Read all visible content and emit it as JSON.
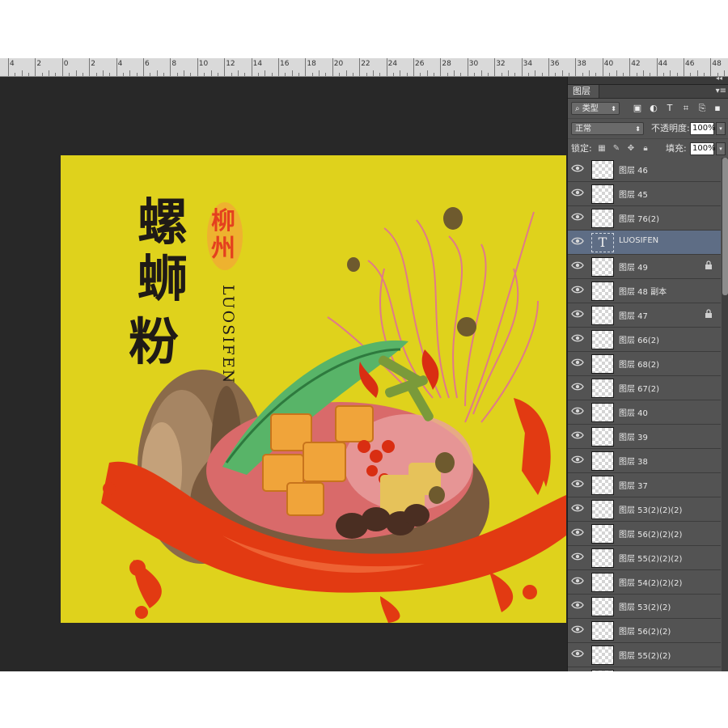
{
  "ruler": {
    "labels": [
      "4",
      "2",
      "0",
      "2",
      "4",
      "6",
      "8",
      "10",
      "12",
      "14",
      "16",
      "18",
      "20",
      "22",
      "24",
      "26",
      "28",
      "30",
      "32",
      "34",
      "36",
      "38",
      "40",
      "42",
      "44",
      "46",
      "48"
    ]
  },
  "artwork": {
    "title_chars": [
      "螺",
      "蛳",
      "粉"
    ],
    "seal_chars": [
      "柳",
      "州"
    ],
    "latin_text": "LUOSIFEN",
    "colors": {
      "background": "#dfd21c",
      "sauce": "#e23a12",
      "title": "#1f1a16",
      "seal": "#e4401e"
    }
  },
  "panel": {
    "tab_label": "图层",
    "menu_icon": "panel-menu-icon",
    "filter": {
      "kind_label": "类型",
      "icons": [
        "image-filter-icon",
        "adjustment-filter-icon",
        "text-filter-icon",
        "shape-filter-icon",
        "smart-object-filter-icon"
      ]
    },
    "blend": {
      "mode": "正常",
      "opacity_label": "不透明度:",
      "opacity_value": "100%"
    },
    "lock": {
      "label": "锁定:",
      "icons": [
        "lock-transparent-icon",
        "lock-image-icon",
        "lock-position-icon",
        "lock-all-icon"
      ],
      "fill_label": "填充:",
      "fill_value": "100%"
    },
    "layers": [
      {
        "name": "图层 46",
        "selected": false,
        "text": false,
        "locked": false
      },
      {
        "name": "图层 45",
        "selected": false,
        "text": false,
        "locked": false
      },
      {
        "name": "图层 76(2)",
        "selected": false,
        "text": false,
        "locked": false
      },
      {
        "name": "LUOSIFEN",
        "selected": true,
        "text": true,
        "locked": false
      },
      {
        "name": "图层 49",
        "selected": false,
        "text": false,
        "locked": true
      },
      {
        "name": "图层 48 副本",
        "selected": false,
        "text": false,
        "locked": false
      },
      {
        "name": "图层 47",
        "selected": false,
        "text": false,
        "locked": true
      },
      {
        "name": "图层 66(2)",
        "selected": false,
        "text": false,
        "locked": false
      },
      {
        "name": "图层 68(2)",
        "selected": false,
        "text": false,
        "locked": false
      },
      {
        "name": "图层 67(2)",
        "selected": false,
        "text": false,
        "locked": false
      },
      {
        "name": "图层 40",
        "selected": false,
        "text": false,
        "locked": false
      },
      {
        "name": "图层 39",
        "selected": false,
        "text": false,
        "locked": false
      },
      {
        "name": "图层 38",
        "selected": false,
        "text": false,
        "locked": false
      },
      {
        "name": "图层 37",
        "selected": false,
        "text": false,
        "locked": false
      },
      {
        "name": "图层 53(2)(2)(2)",
        "selected": false,
        "text": false,
        "locked": false
      },
      {
        "name": "图层 56(2)(2)(2)",
        "selected": false,
        "text": false,
        "locked": false
      },
      {
        "name": "图层 55(2)(2)(2)",
        "selected": false,
        "text": false,
        "locked": false
      },
      {
        "name": "图层 54(2)(2)(2)",
        "selected": false,
        "text": false,
        "locked": false
      },
      {
        "name": "图层 53(2)(2)",
        "selected": false,
        "text": false,
        "locked": false
      },
      {
        "name": "图层 56(2)(2)",
        "selected": false,
        "text": false,
        "locked": false
      },
      {
        "name": "图层 55(2)(2)",
        "selected": false,
        "text": false,
        "locked": false
      },
      {
        "name": "",
        "selected": false,
        "text": false,
        "locked": false
      }
    ]
  }
}
